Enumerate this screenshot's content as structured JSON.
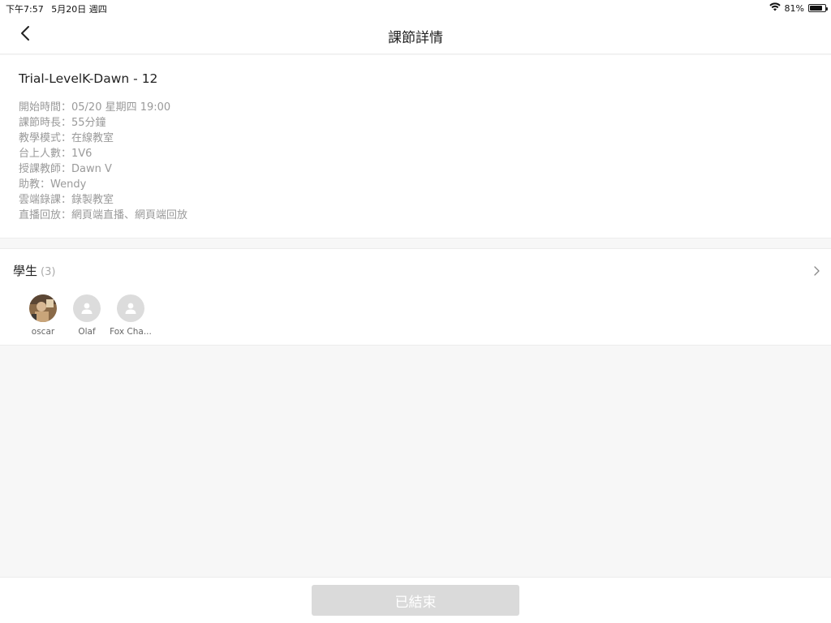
{
  "status_bar": {
    "time": "下午7:57",
    "date": "5月20日 週四",
    "battery_text": "81%",
    "battery_level": 0.81
  },
  "nav": {
    "title": "課節詳情"
  },
  "lesson": {
    "title": "Trial-LevelK-Dawn - 12",
    "info": [
      "開始時間：05/20 星期四 19:00",
      "課節時長：55分鐘",
      "教學模式：在線教室",
      "台上人數：1V6",
      "授課教師：Dawn V",
      "助教：Wendy",
      "雲端錄課：錄製教室",
      "直播回放：網頁端直播、網頁端回放"
    ]
  },
  "students": {
    "title": "學生",
    "count": "(3)",
    "list": [
      {
        "name": "oscar",
        "avatar": "photo"
      },
      {
        "name": "Olaf",
        "avatar": "default-avatar-icon"
      },
      {
        "name": "Fox Cha...",
        "avatar": "default-avatar-icon"
      }
    ]
  },
  "footer": {
    "button_label": "已結束"
  },
  "colors": {
    "background": "#f7f7f7",
    "card": "#ffffff",
    "secondary_text": "#9a9a9a",
    "disabled_button": "#dadada"
  }
}
